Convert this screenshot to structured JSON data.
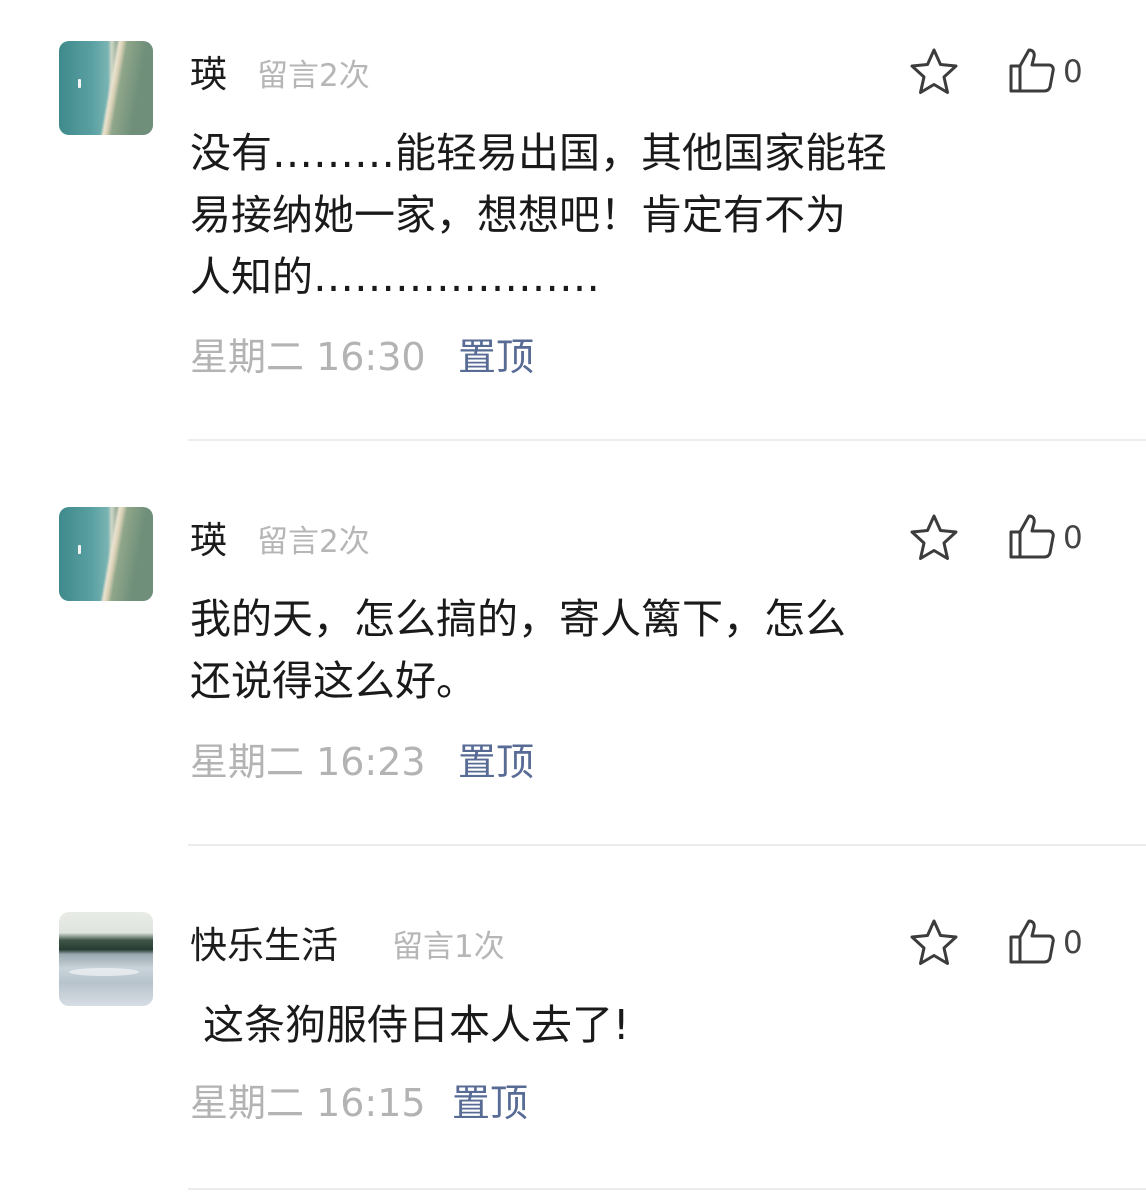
{
  "comments": [
    {
      "author": "瑛",
      "count_label": "留言2次",
      "text": "没有………能轻易出国，其他国家能轻\n易接纳她一家，想想吧！肯定有不为\n人知的…………………",
      "time": "星期二 16:30",
      "pin_label": "置顶",
      "likes": "0"
    },
    {
      "author": "瑛",
      "count_label": "留言2次",
      "text": "我的天，怎么搞的，寄人篱下，怎么\n还说得这么好。",
      "time": "星期二 16:23",
      "pin_label": "置顶",
      "likes": "0"
    },
    {
      "author": "快乐生活",
      "count_label": "留言1次",
      "text": " 这条狗服侍日本人去了!",
      "time": "星期二 16:15",
      "pin_label": "置顶",
      "likes": "0"
    }
  ],
  "icons": {
    "favorite": "star-outline-icon",
    "like": "thumbs-up-outline-icon"
  },
  "colors": {
    "pin_link": "#576b95",
    "meta_gray": "#b3b3b3"
  }
}
